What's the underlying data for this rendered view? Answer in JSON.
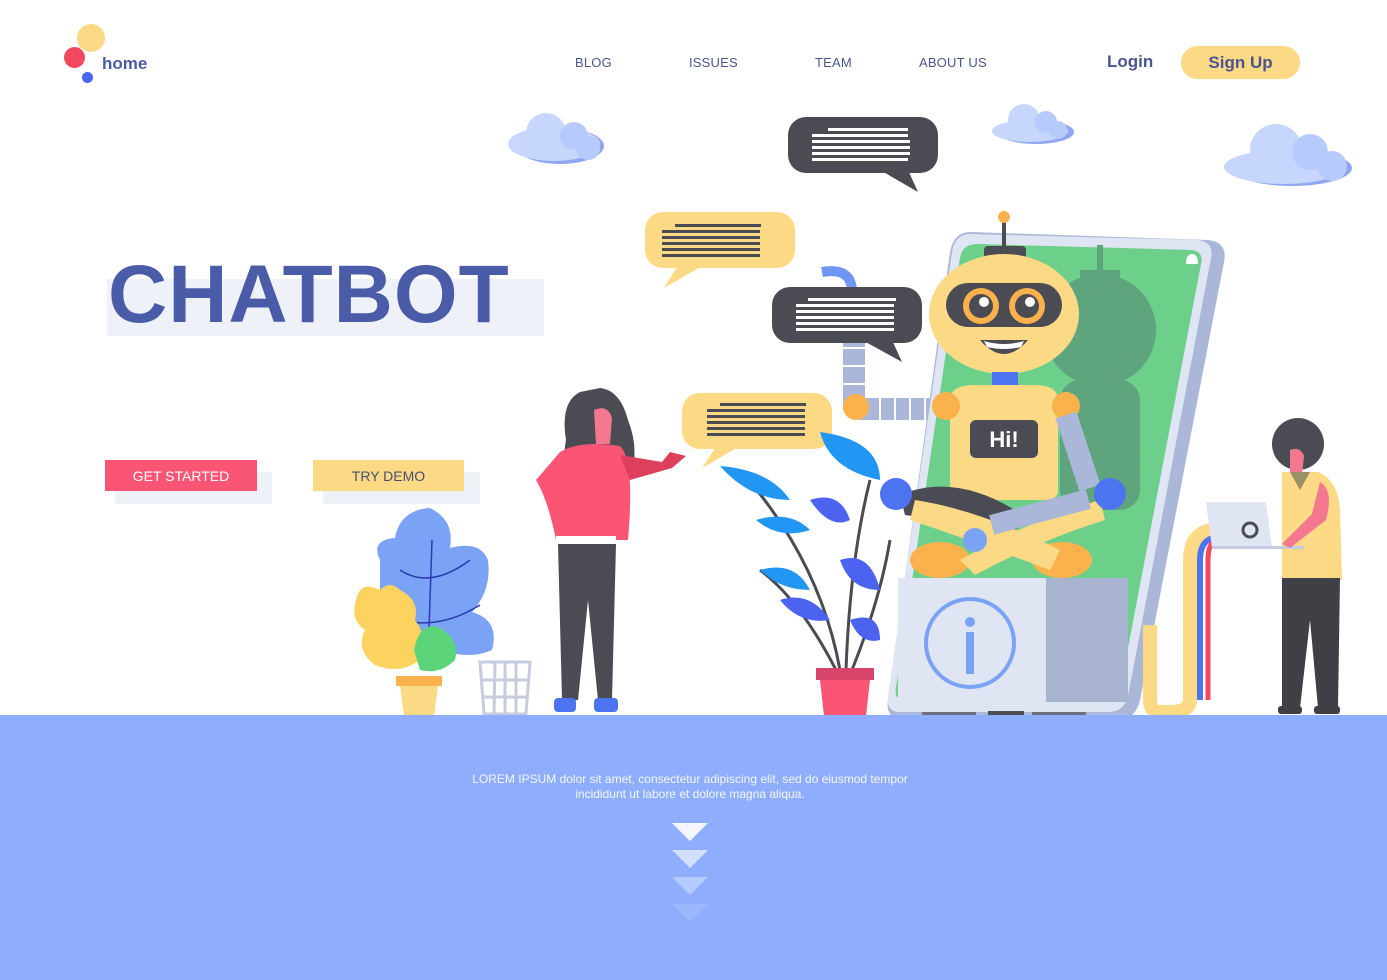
{
  "header": {
    "logo_label": "home",
    "nav": [
      {
        "label": "BLOG"
      },
      {
        "label": "ISSUES"
      },
      {
        "label": "TEAM"
      },
      {
        "label": "ABOUT US"
      }
    ],
    "login_label": "Login",
    "signup_label": "Sign Up"
  },
  "hero": {
    "title": "CHATBOT",
    "buttons": {
      "get_started": "GET STARTED",
      "try_demo": "TRY DEMO"
    }
  },
  "illustration": {
    "robot_badge": "Hi!",
    "phone_icon": "info-icon",
    "notification_icon": "bell-icon"
  },
  "footer": {
    "lorem_line1": "LOREM IPSUM dolor sit amet, consectetur adipiscing elit, sed do eiusmod tempor",
    "lorem_line2": "incididunt ut labore et dolore magna aliqua.",
    "scroll_icon": "chevron-down-icon"
  },
  "colors": {
    "brand_blue": "#4a5ca8",
    "accent_red": "#fa5575",
    "accent_yellow": "#fcd985",
    "band_blue": "#8eaefd",
    "phone_green": "#6ccf8a"
  }
}
